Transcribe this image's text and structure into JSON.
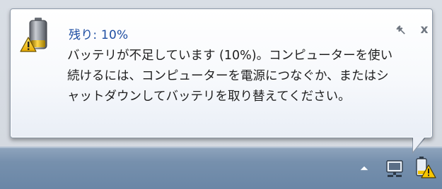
{
  "notification": {
    "title": "残り: 10%",
    "message": "バッテリが不足しています (10%)。コンピューターを使い続けるには、コンピューターを電源につなぐか、またはシャットダウンしてバッテリを取り替えてください。",
    "icon": "battery-warning-icon",
    "controls": {
      "options_icon": "wrench-icon",
      "close_label": "x"
    }
  },
  "tray": {
    "icons": [
      "show-hidden-icons-arrow",
      "network-icon",
      "battery-warning-icon"
    ]
  },
  "colors": {
    "title": "#1e4ea2",
    "text": "#1f1f1f",
    "taskbar": "#7690ad",
    "warning": "#f2c300"
  }
}
